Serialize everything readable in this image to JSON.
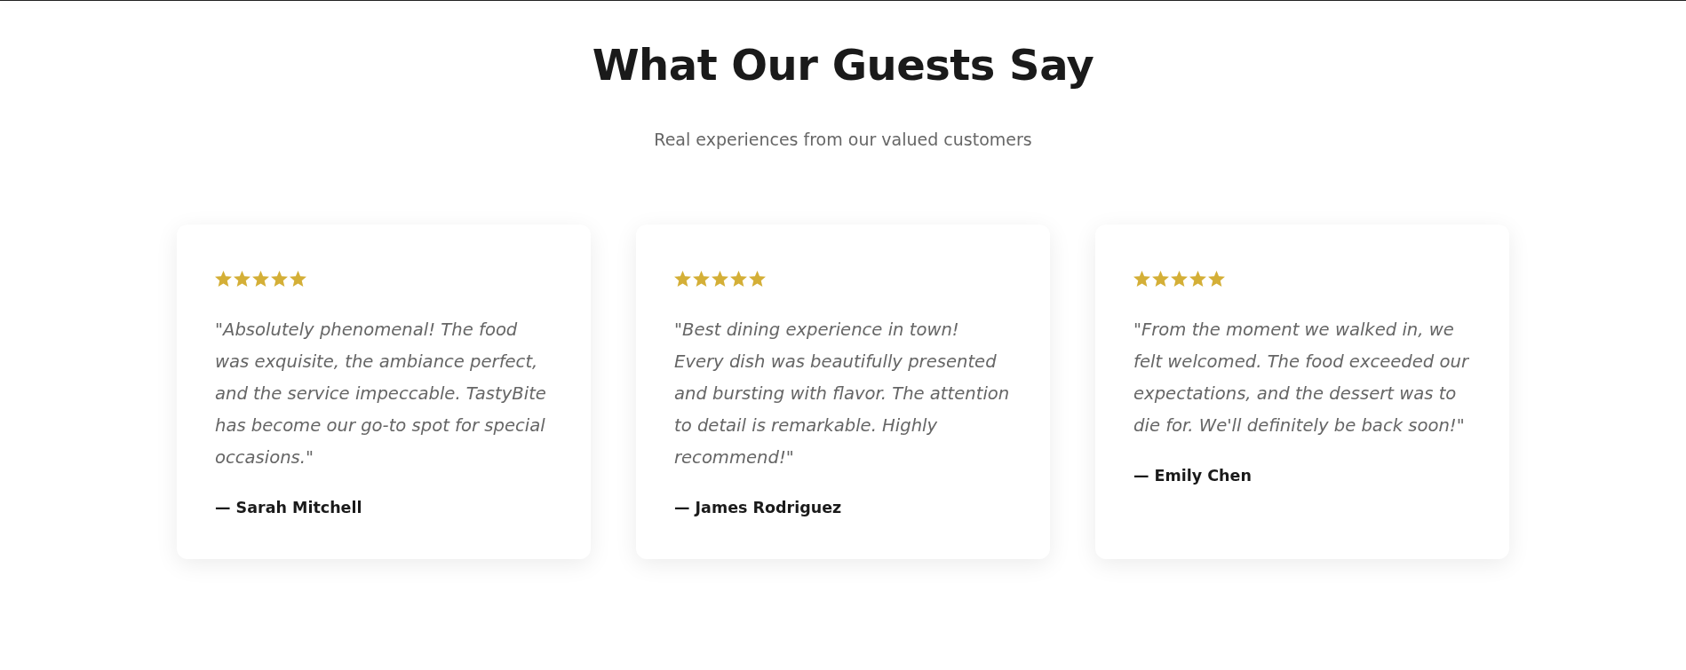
{
  "section": {
    "title": "What Our Guests Say",
    "subtitle": "Real experiences from our valued customers"
  },
  "testimonials": [
    {
      "stars": 5,
      "quote": "\"Absolutely phenomenal! The food was exquisite, the ambiance perfect, and the service impeccable. TastyBite has become our go-to spot for special occasions.\"",
      "author": "— Sarah Mitchell"
    },
    {
      "stars": 5,
      "quote": "\"Best dining experience in town! Every dish was beautifully presented and bursting with flavor. The attention to detail is remarkable. Highly recommend!\"",
      "author": "— James Rodriguez"
    },
    {
      "stars": 5,
      "quote": "\"From the moment we walked in, we felt welcomed. The food exceeded our expectations, and the dessert was to die for. We'll definitely be back soon!\"",
      "author": "— Emily Chen"
    }
  ]
}
